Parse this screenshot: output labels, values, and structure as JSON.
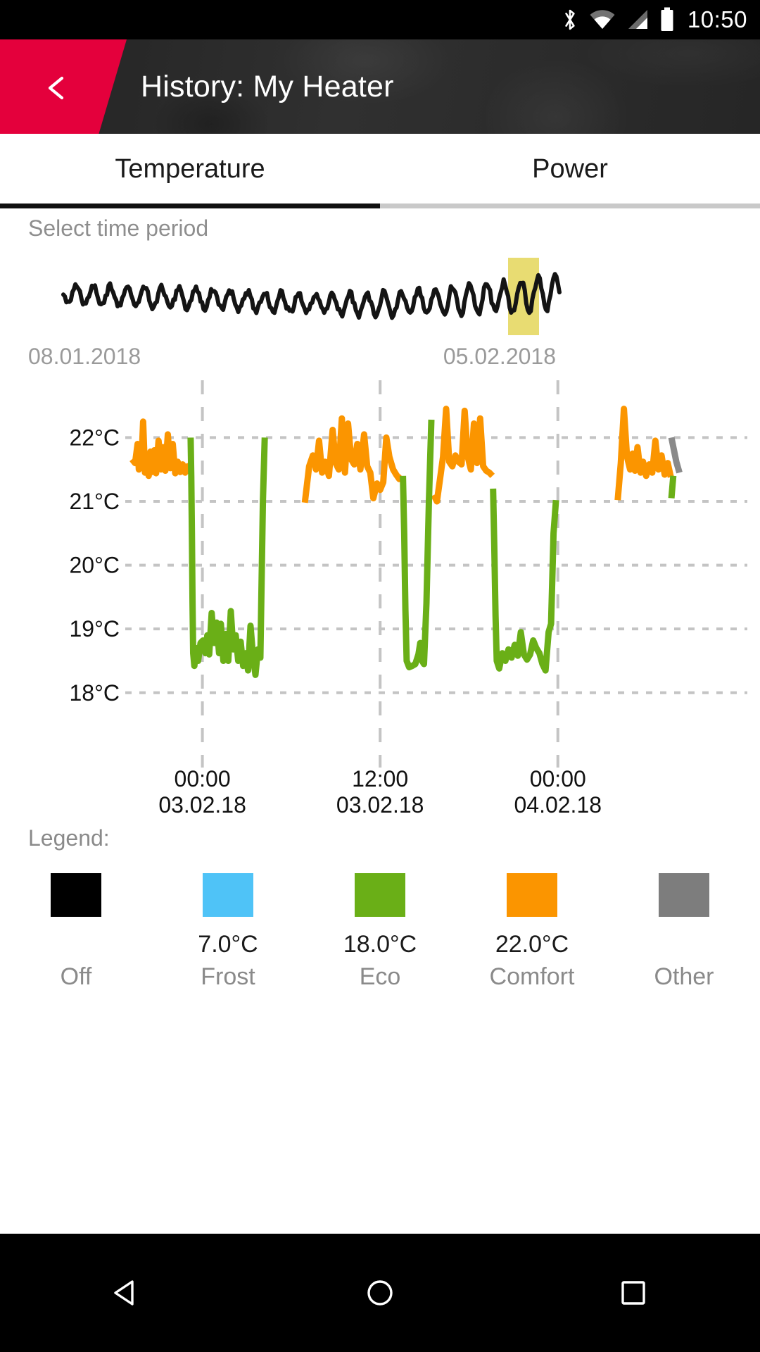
{
  "status_bar": {
    "time": "10:50",
    "icons": [
      "bluetooth-icon",
      "wifi-icon",
      "cellular-signal-icon",
      "battery-icon"
    ]
  },
  "header": {
    "title": "History: My Heater",
    "back_icon": "chevron-left-icon",
    "accent_color": "#e4003c",
    "background_color": "#2c2c2c"
  },
  "tabs": [
    {
      "label": "Temperature",
      "active": true
    },
    {
      "label": "Power",
      "active": false
    }
  ],
  "time_period": {
    "label": "Select time period",
    "range_start": "08.01.2018",
    "range_end": "05.02.2018",
    "selection_color": "#e8dc72",
    "sparkline_color": "#141414"
  },
  "legend": {
    "title": "Legend:",
    "items": [
      {
        "name": "Off",
        "value": "",
        "color": "#000000"
      },
      {
        "name": "Frost",
        "value": "7.0°C",
        "color": "#4fc3f7"
      },
      {
        "name": "Eco",
        "value": "18.0°C",
        "color": "#6aaf17"
      },
      {
        "name": "Comfort",
        "value": "22.0°C",
        "color": "#fb9500"
      },
      {
        "name": "Other",
        "value": "",
        "color": "#7d7d7d"
      }
    ]
  },
  "nav_bar": {
    "back_label": "back-triangle-icon",
    "home_label": "home-circle-icon",
    "recents_label": "recents-square-icon"
  },
  "chart_data": {
    "type": "line",
    "title": "",
    "xlabel": "",
    "ylabel": "",
    "ylim": [
      17.6,
      22.7
    ],
    "grid": true,
    "y_ticks": [
      22,
      21,
      20,
      19,
      18
    ],
    "y_tick_labels": [
      "22°C",
      "21°C",
      "20°C",
      "19°C",
      "18°C"
    ],
    "x_ticks": [
      {
        "time": "00:00",
        "date": "03.02.18"
      },
      {
        "time": "12:00",
        "date": "03.02.18"
      },
      {
        "time": "00:00",
        "date": "04.02.18"
      }
    ],
    "series": [
      {
        "name": "Comfort",
        "color": "#fb9500",
        "mode_temperature": 22.0,
        "segments": [
          [
            [
              0.003,
              21.66
            ],
            [
              0.008,
              21.6
            ],
            [
              0.012,
              21.9
            ],
            [
              0.014,
              21.5
            ],
            [
              0.018,
              21.55
            ],
            [
              0.021,
              22.25
            ],
            [
              0.024,
              21.45
            ],
            [
              0.027,
              21.72
            ],
            [
              0.03,
              21.4
            ],
            [
              0.033,
              21.78
            ],
            [
              0.036,
              21.46
            ],
            [
              0.039,
              21.8
            ],
            [
              0.042,
              21.44
            ],
            [
              0.046,
              21.95
            ],
            [
              0.05,
              21.5
            ],
            [
              0.053,
              21.85
            ],
            [
              0.057,
              21.48
            ],
            [
              0.061,
              22.05
            ],
            [
              0.065,
              21.52
            ],
            [
              0.069,
              21.9
            ],
            [
              0.073,
              21.44
            ],
            [
              0.077,
              21.62
            ],
            [
              0.081,
              21.46
            ],
            [
              0.085,
              21.58
            ],
            [
              0.089,
              21.45
            ],
            [
              0.093,
              21.55
            ],
            [
              0.097,
              21.44
            ]
          ],
          [
            [
              0.283,
              20.98
            ],
            [
              0.29,
              21.55
            ],
            [
              0.296,
              21.72
            ],
            [
              0.301,
              21.5
            ],
            [
              0.306,
              21.95
            ],
            [
              0.311,
              21.45
            ],
            [
              0.316,
              21.62
            ],
            [
              0.322,
              21.4
            ],
            [
              0.328,
              22.12
            ],
            [
              0.333,
              21.6
            ],
            [
              0.338,
              21.5
            ],
            [
              0.343,
              22.3
            ],
            [
              0.348,
              21.45
            ],
            [
              0.353,
              22.22
            ],
            [
              0.358,
              21.66
            ],
            [
              0.363,
              21.58
            ],
            [
              0.368,
              21.9
            ],
            [
              0.373,
              21.5
            ],
            [
              0.379,
              22.05
            ],
            [
              0.384,
              21.55
            ],
            [
              0.389,
              21.45
            ],
            [
              0.394,
              21.05
            ],
            [
              0.4,
              21.28
            ],
            [
              0.405,
              21.18
            ],
            [
              0.41,
              21.3
            ],
            [
              0.415,
              22.0
            ],
            [
              0.42,
              21.7
            ],
            [
              0.426,
              21.5
            ],
            [
              0.431,
              21.42
            ],
            [
              0.436,
              21.35
            ],
            [
              0.441,
              21.38
            ]
          ],
          [
            [
              0.492,
              21.1
            ],
            [
              0.497,
              21.0
            ],
            [
              0.502,
              21.35
            ],
            [
              0.507,
              21.7
            ],
            [
              0.512,
              22.45
            ],
            [
              0.517,
              21.62
            ],
            [
              0.522,
              21.55
            ],
            [
              0.527,
              21.72
            ],
            [
              0.532,
              21.62
            ],
            [
              0.537,
              21.58
            ],
            [
              0.542,
              22.42
            ],
            [
              0.547,
              21.7
            ],
            [
              0.552,
              21.5
            ],
            [
              0.557,
              22.22
            ],
            [
              0.562,
              21.6
            ],
            [
              0.567,
              22.3
            ],
            [
              0.572,
              21.55
            ],
            [
              0.577,
              21.48
            ],
            [
              0.582,
              21.45
            ],
            [
              0.587,
              21.4
            ]
          ],
          [
            [
              0.79,
              21.02
            ],
            [
              0.795,
              21.6
            ],
            [
              0.8,
              22.45
            ],
            [
              0.805,
              21.7
            ],
            [
              0.81,
              21.5
            ],
            [
              0.814,
              21.75
            ],
            [
              0.818,
              21.48
            ],
            [
              0.822,
              21.85
            ],
            [
              0.827,
              21.45
            ],
            [
              0.831,
              21.62
            ],
            [
              0.836,
              21.4
            ],
            [
              0.841,
              21.58
            ],
            [
              0.846,
              21.45
            ],
            [
              0.851,
              21.95
            ],
            [
              0.856,
              21.5
            ],
            [
              0.861,
              21.72
            ],
            [
              0.866,
              21.42
            ],
            [
              0.871,
              21.6
            ],
            [
              0.876,
              21.38
            ]
          ]
        ]
      },
      {
        "name": "Eco",
        "color": "#6aaf17",
        "mode_temperature": 18.0,
        "segments": [
          [
            [
              0.098,
              22.0
            ],
            [
              0.099,
              21.4
            ],
            [
              0.1,
              20.5
            ],
            [
              0.101,
              19.4
            ],
            [
              0.102,
              18.62
            ],
            [
              0.104,
              18.42
            ],
            [
              0.107,
              18.7
            ],
            [
              0.11,
              18.5
            ],
            [
              0.114,
              18.78
            ],
            [
              0.118,
              18.82
            ],
            [
              0.122,
              18.62
            ],
            [
              0.125,
              18.9
            ],
            [
              0.128,
              18.6
            ],
            [
              0.132,
              19.25
            ],
            [
              0.136,
              18.78
            ],
            [
              0.14,
              19.1
            ],
            [
              0.144,
              18.62
            ],
            [
              0.147,
              19.08
            ],
            [
              0.151,
              18.5
            ],
            [
              0.155,
              18.92
            ],
            [
              0.159,
              18.5
            ],
            [
              0.163,
              19.28
            ],
            [
              0.167,
              18.68
            ],
            [
              0.171,
              18.9
            ],
            [
              0.175,
              18.5
            ],
            [
              0.179,
              18.8
            ],
            [
              0.183,
              18.42
            ],
            [
              0.187,
              18.62
            ],
            [
              0.191,
              18.35
            ],
            [
              0.195,
              19.05
            ],
            [
              0.199,
              18.58
            ],
            [
              0.203,
              18.28
            ],
            [
              0.207,
              18.68
            ],
            [
              0.211,
              18.55
            ],
            [
              0.215,
              21.0
            ],
            [
              0.218,
              22.0
            ]
          ],
          [
            [
              0.442,
              21.4
            ],
            [
              0.444,
              20.5
            ],
            [
              0.446,
              19.3
            ],
            [
              0.448,
              18.5
            ],
            [
              0.452,
              18.4
            ],
            [
              0.457,
              18.42
            ],
            [
              0.462,
              18.45
            ],
            [
              0.467,
              18.6
            ],
            [
              0.47,
              18.78
            ],
            [
              0.473,
              18.5
            ],
            [
              0.476,
              18.45
            ],
            [
              0.48,
              19.4
            ],
            [
              0.484,
              21.0
            ],
            [
              0.488,
              22.28
            ]
          ],
          [
            [
              0.588,
              21.2
            ],
            [
              0.59,
              20.3
            ],
            [
              0.592,
              19.2
            ],
            [
              0.594,
              18.5
            ],
            [
              0.598,
              18.38
            ],
            [
              0.603,
              18.62
            ],
            [
              0.608,
              18.5
            ],
            [
              0.613,
              18.68
            ],
            [
              0.618,
              18.55
            ],
            [
              0.623,
              18.75
            ],
            [
              0.628,
              18.58
            ],
            [
              0.633,
              18.95
            ],
            [
              0.638,
              18.6
            ],
            [
              0.643,
              18.52
            ],
            [
              0.648,
              18.6
            ],
            [
              0.653,
              18.82
            ],
            [
              0.658,
              18.7
            ],
            [
              0.663,
              18.62
            ],
            [
              0.668,
              18.45
            ],
            [
              0.673,
              18.35
            ],
            [
              0.678,
              18.95
            ],
            [
              0.682,
              19.08
            ],
            [
              0.686,
              20.5
            ],
            [
              0.69,
              21.02
            ]
          ],
          [
            [
              0.877,
              21.05
            ],
            [
              0.88,
              21.4
            ]
          ]
        ]
      },
      {
        "name": "Other",
        "color": "#8a8a8a",
        "segments": [
          [
            [
              0.877,
              22.0
            ],
            [
              0.885,
              21.62
            ],
            [
              0.89,
              21.45
            ]
          ]
        ]
      }
    ]
  }
}
